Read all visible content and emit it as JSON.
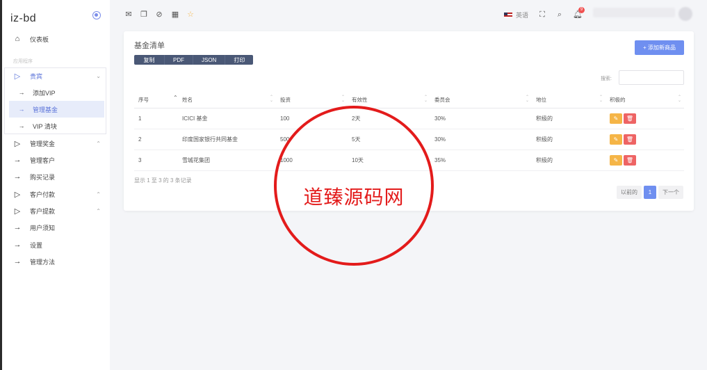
{
  "brand": {
    "title": "iz-bd"
  },
  "sidebar": {
    "dashboard": "仪表板",
    "section": "应用程序",
    "vip": "贵宾",
    "vip_sub": [
      "添加VIP",
      "管理基金",
      "VIP 清块"
    ],
    "items": [
      {
        "label": "管理奖金",
        "icon": "play-outline",
        "caret": true
      },
      {
        "label": "管理客户",
        "icon": "arrow-right",
        "caret": false
      },
      {
        "label": "购买记录",
        "icon": "arrow-right",
        "caret": false
      },
      {
        "label": "客户付款",
        "icon": "play-outline",
        "caret": true
      },
      {
        "label": "客户提款",
        "icon": "play-outline",
        "caret": true
      },
      {
        "label": "用户须知",
        "icon": "arrow-right",
        "caret": false
      },
      {
        "label": "设置",
        "icon": "arrow-right",
        "caret": false
      },
      {
        "label": "管理方法",
        "icon": "arrow-right",
        "caret": false
      }
    ]
  },
  "topbar": {
    "language": "英语",
    "notif_count": "9",
    "icons": [
      "mail-icon",
      "chat-icon",
      "check-circle-icon",
      "calendar-icon",
      "star-icon"
    ]
  },
  "card": {
    "title": "基金清单",
    "export_buttons": [
      "复制",
      "PDF",
      "JSON",
      "打印"
    ],
    "add_button": "+ 添加新商品",
    "search_label": "搜索:",
    "columns": [
      "序号",
      "姓名",
      "投资",
      "有效性",
      "委员会",
      "地位",
      "积极的"
    ],
    "rows": [
      [
        "1",
        "ICICI 基金",
        "100",
        "2天",
        "30%",
        "积极的"
      ],
      [
        "2",
        "印度国家银行共同基金",
        "500",
        "5天",
        "30%",
        "积极的"
      ],
      [
        "3",
        "雪城花集团",
        "1000",
        "10天",
        "35%",
        "积极的"
      ]
    ],
    "info": "显示 1 至 3 的 3 条记录",
    "pager": {
      "prev": "以前的",
      "current": "1",
      "next": "下一个"
    }
  },
  "watermark": {
    "text": "道臻源码网"
  },
  "colors": {
    "accent": "#6f8ff0",
    "stamp": "#e31b1b",
    "edit": "#f5b547",
    "delete": "#ee6464"
  }
}
